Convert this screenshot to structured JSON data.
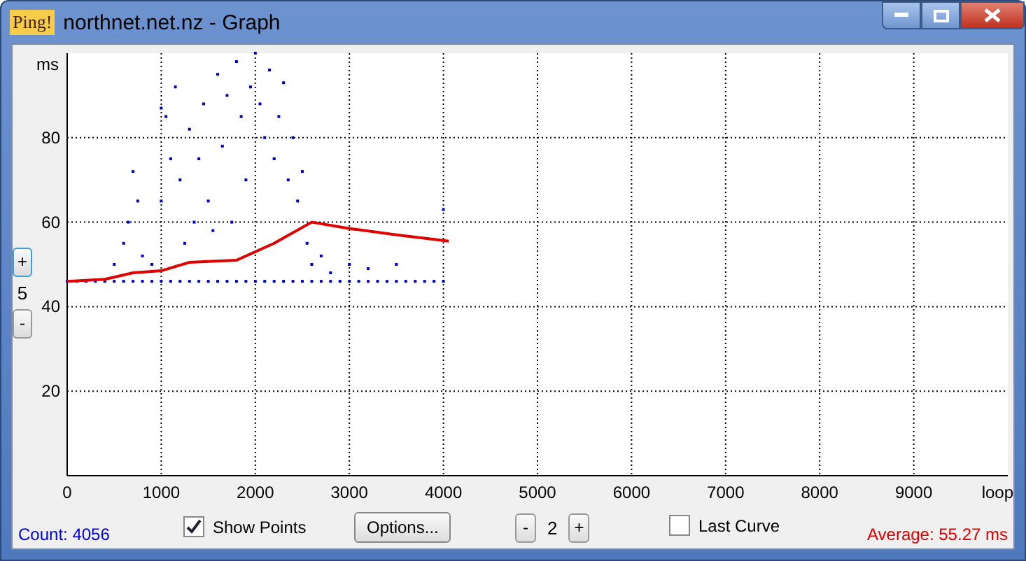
{
  "window": {
    "title": "northnet.net.nz - Graph",
    "app_icon_text": "Ping!"
  },
  "zoom": {
    "plus": "+",
    "value": "5",
    "minus": "-"
  },
  "chart_data": {
    "type": "scatter",
    "ylabel": "ms",
    "xlabel": "loop",
    "xlim": [
      0,
      10000
    ],
    "ylim": [
      0,
      100
    ],
    "grid": true,
    "xticks": [
      0,
      1000,
      2000,
      3000,
      4000,
      5000,
      6000,
      7000,
      8000,
      9000
    ],
    "yticks": [
      20,
      40,
      60,
      80
    ],
    "series": [
      {
        "type": "scatter",
        "color": "#0000c0",
        "x": [
          0,
          100,
          200,
          300,
          400,
          500,
          600,
          700,
          800,
          900,
          1000,
          1100,
          1200,
          1300,
          1400,
          1500,
          1600,
          1700,
          1800,
          1900,
          2000,
          2100,
          2200,
          2300,
          2400,
          2500,
          2600,
          2700,
          2800,
          2900,
          3000,
          3100,
          3200,
          3300,
          3400,
          3500,
          3600,
          3700,
          3800,
          3900,
          4000,
          500,
          600,
          650,
          700,
          750,
          800,
          900,
          1000,
          1000,
          1050,
          1100,
          1150,
          1200,
          1250,
          1300,
          1350,
          1400,
          1450,
          1500,
          1550,
          1600,
          1650,
          1700,
          1750,
          1800,
          1850,
          1900,
          1950,
          2000,
          2050,
          2100,
          2150,
          2200,
          2250,
          2300,
          2350,
          2400,
          2450,
          2500,
          2550,
          2600,
          2700,
          2800,
          3000,
          3200,
          3500,
          4000
        ],
        "values": [
          46,
          46,
          46,
          46,
          46,
          46,
          46,
          46,
          46,
          46,
          46,
          46,
          46,
          46,
          46,
          46,
          46,
          46,
          46,
          46,
          46,
          46,
          46,
          46,
          46,
          46,
          46,
          46,
          46,
          46,
          46,
          46,
          46,
          46,
          46,
          46,
          46,
          46,
          46,
          46,
          46,
          50,
          55,
          60,
          72,
          65,
          52,
          50,
          65,
          87,
          85,
          75,
          92,
          70,
          55,
          82,
          60,
          75,
          88,
          65,
          58,
          95,
          78,
          90,
          60,
          98,
          85,
          70,
          92,
          100,
          88,
          80,
          96,
          75,
          85,
          93,
          70,
          80,
          65,
          72,
          55,
          50,
          52,
          48,
          50,
          49,
          50,
          63
        ]
      },
      {
        "type": "line",
        "color": "#e00000",
        "x": [
          0,
          400,
          700,
          1000,
          1300,
          1800,
          2200,
          2600,
          3000,
          3500,
          4056
        ],
        "values": [
          46,
          46.5,
          48,
          48.5,
          50.5,
          51,
          55,
          60,
          58.5,
          57,
          55.5
        ]
      }
    ]
  },
  "bottom": {
    "count": "Count: 4056",
    "show_points": {
      "label": "Show Points",
      "checked": true
    },
    "options": "Options...",
    "curve_minus": "-",
    "curve_value": "2",
    "curve_plus": "+",
    "last_curve": {
      "label": "Last Curve",
      "checked": false
    },
    "average": "Average: 55.27 ms"
  }
}
